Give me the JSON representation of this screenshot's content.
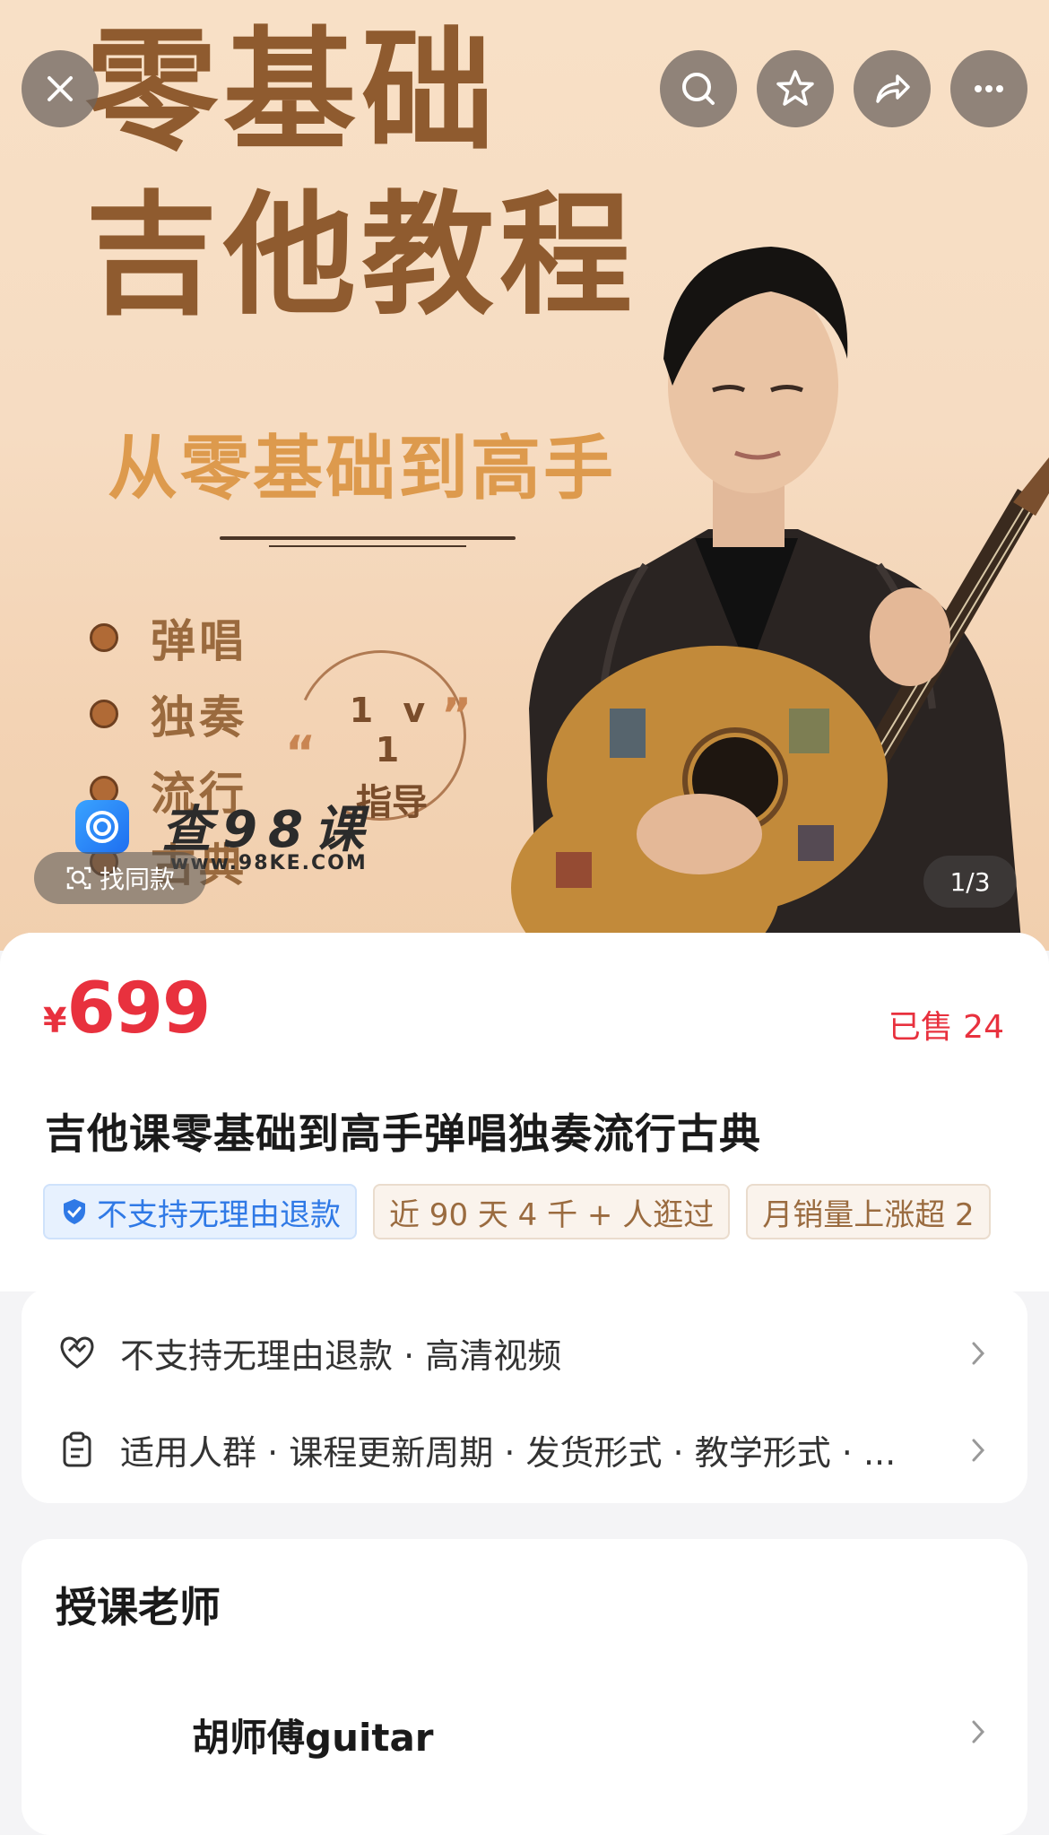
{
  "hero": {
    "title_line1": "零基础",
    "title_line2": "吉他教程",
    "subtitle": "从零基础到高手",
    "bullets": [
      "弹唱",
      "独奏",
      "流行",
      "古典"
    ],
    "badge_line1": "1 v 1",
    "badge_line2": "指导",
    "watermark_text": "查98课",
    "watermark_url": "www.98KE.COM",
    "find_same": "找同款",
    "pager": "1/3"
  },
  "product": {
    "currency": "¥",
    "price": "699",
    "sold": "已售 24",
    "title": "吉他课零基础到高手弹唱独奏流行古典",
    "tags": [
      "不支持无理由退款",
      "近 90 天 4 千 + 人逛过",
      "月销量上涨超 2"
    ]
  },
  "info": {
    "row1": "不支持无理由退款 · 高清视频",
    "row2": "适用人群 · 课程更新周期 · 发货形式 · 教学形式 · ..."
  },
  "teacher": {
    "section_title": "授课老师",
    "name": "胡师傅guitar"
  }
}
